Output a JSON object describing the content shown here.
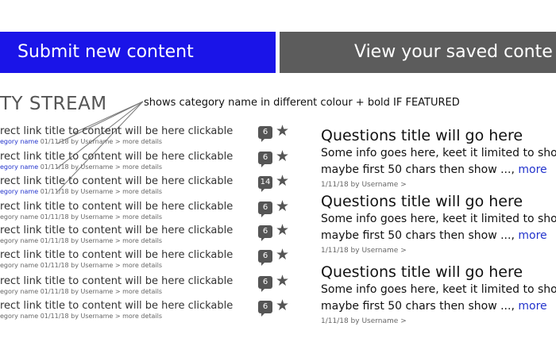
{
  "buttons": {
    "submit_label": "Submit new content",
    "saved_label": "View your saved conte"
  },
  "stream": {
    "heading": "TY STREAM",
    "annotation": "shows category name in different colour + bold IF FEATURED",
    "items": [
      {
        "title": "rect link title to content will be here clickable",
        "category": "egory name",
        "meta": " 01/11/18 by Username > more details",
        "count": "6",
        "featured": true
      },
      {
        "title": "rect link title to content will be here clickable",
        "category": "egory name",
        "meta": " 01/11/18 by Username > more details",
        "count": "6",
        "featured": true
      },
      {
        "title": "rect link title to content will be here clickable",
        "category": "egory name",
        "meta": " 01/11/18 by Username > more details",
        "count": "14",
        "featured": true
      },
      {
        "title": "rect link title to content will be here clickable",
        "category": "egory name",
        "meta": " 01/11/18 by Username > more details",
        "count": "6",
        "featured": false
      },
      {
        "title": "rect link title to content will be here clickable",
        "category": "egory name",
        "meta": " 01/11/18 by Username > more details",
        "count": "6",
        "featured": false
      },
      {
        "title": "rect link title to content will be here clickable",
        "category": "egory name",
        "meta": " 01/11/18 by Username > more details",
        "count": "6",
        "featured": false
      },
      {
        "title": "rect link title to content will be here clickable",
        "category": "egory name",
        "meta": " 01/11/18 by Username > more details",
        "count": "6",
        "featured": false
      },
      {
        "title": "rect link title to content will be here clickable",
        "category": "egory name",
        "meta": " 01/11/18 by Username > more details",
        "count": "6",
        "featured": false
      }
    ]
  },
  "icons": {
    "star": "star-icon"
  },
  "colors": {
    "submit_bg": "#1a14e8",
    "saved_bg": "#5c5c5c",
    "featured_category": "#2233cc",
    "more_link": "#2233cc"
  },
  "questions": [
    {
      "title": "Questions title will go here",
      "line1": "Some info goes here, keet it limited to sho",
      "line2": "maybe first 50 chars then show ..., ",
      "more": "more",
      "meta": "1/11/18 by Username >"
    },
    {
      "title": "Questions title will go here",
      "line1": "Some info goes here, keet it limited to sho",
      "line2": "maybe first 50 chars then show ..., ",
      "more": "more",
      "meta": "1/11/18 by Username >"
    },
    {
      "title": "Questions title will go here",
      "line1": "Some info goes here, keet it limited to sho",
      "line2": "maybe first 50 chars then show ..., ",
      "more": "more",
      "meta": "1/11/18 by Username >"
    }
  ]
}
